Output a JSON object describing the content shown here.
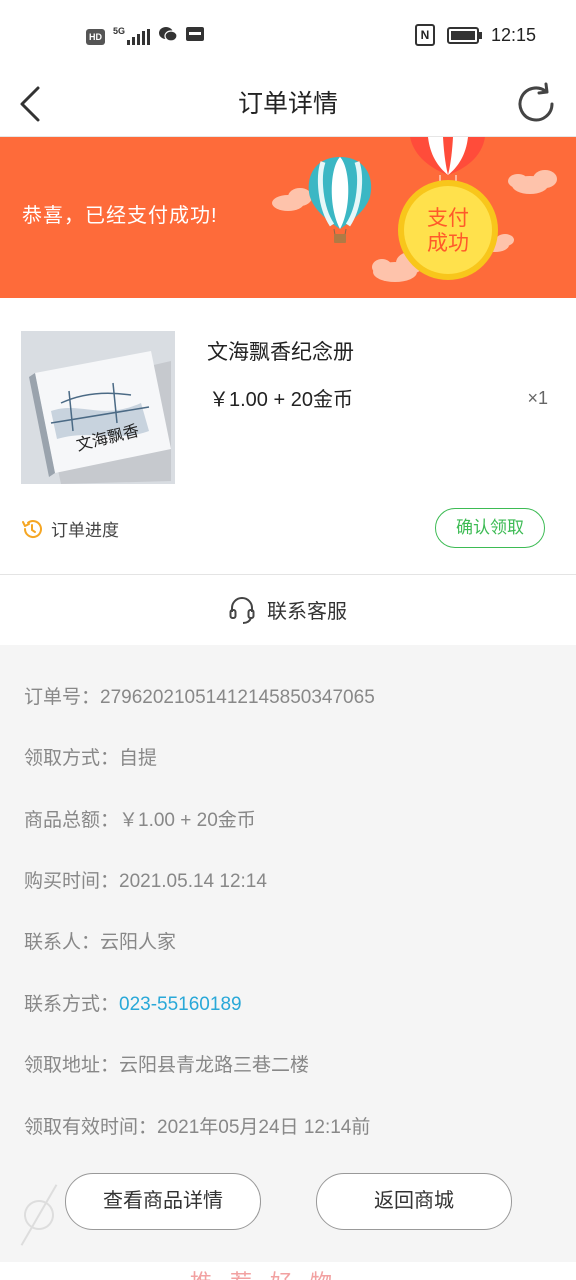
{
  "status_bar": {
    "badge_hd": "HD",
    "network": "5G",
    "nfc": "N",
    "time": "12:15"
  },
  "nav": {
    "title": "订单详情",
    "back_icon": "chevron-left-icon",
    "refresh_icon": "refresh-icon"
  },
  "banner": {
    "message": "恭喜，已经支付成功!",
    "stamp_line1": "支付",
    "stamp_line2": "成功",
    "background": "#fe6b3a"
  },
  "product": {
    "name": "文海飘香纪念册",
    "price": "￥1.00 + 20金币",
    "quantity": "×1",
    "cover_title": "文海飘香"
  },
  "order_progress": {
    "label": "订单进度",
    "confirm_button": "确认领取",
    "accent": "#3dbb54"
  },
  "contact": {
    "label": "联系客服",
    "icon": "headset-icon"
  },
  "details": [
    {
      "label": "订单号：",
      "value": "27962021051412145850347065"
    },
    {
      "label": "领取方式：",
      "value": "自提"
    },
    {
      "label": "商品总额：",
      "value": "￥1.00 + 20金币"
    },
    {
      "label": "购买时间：",
      "value": "2021.05.14 12:14"
    },
    {
      "label": "联系人：",
      "value": "云阳人家"
    },
    {
      "label": "联系方式：",
      "value": "023-55160189"
    },
    {
      "label": "领取地址：",
      "value": "云阳县青龙路三巷二楼"
    },
    {
      "label": "领取有效时间：",
      "value": "2021年05月24日 12:14前"
    }
  ],
  "link_color": "#29a8d8",
  "buttons": {
    "view_detail": "查看商品详情",
    "back_to_mall": "返回商城"
  },
  "bottom_strip": {
    "text": "推荐好物"
  }
}
